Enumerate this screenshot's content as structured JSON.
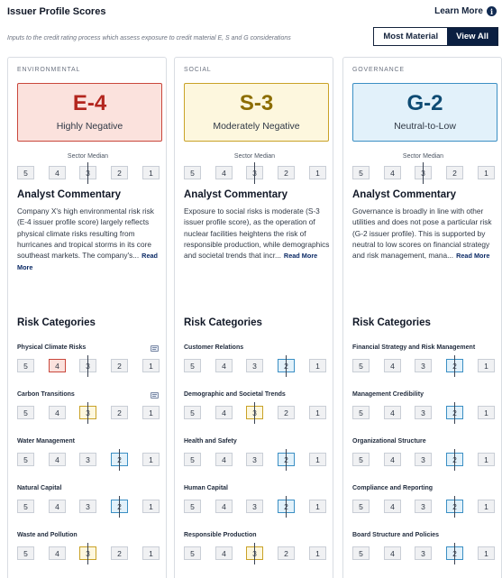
{
  "header": {
    "title": "Issuer Profile Scores",
    "learn_more": "Learn More",
    "info_icon": "info-icon",
    "subtitle": "Inputs to the credit rating process which assess exposure to credit material E, S and G considerations"
  },
  "toggle": {
    "most_material": "Most Material",
    "view_all": "View All",
    "active": "View All"
  },
  "colors": {
    "negative_fill": "#fbe2dd",
    "negative_border": "#c9473c",
    "negative_text": "#b3261e",
    "moderate_fill": "#fdf7de",
    "moderate_border": "#c9a227",
    "moderate_text": "#8c6d00",
    "neutral_fill": "#e2f1fa",
    "neutral_border": "#3b8fc4",
    "neutral_text": "#0e4b73",
    "scale_cell": "#f0f1f3"
  },
  "scale_labels": [
    "5",
    "4",
    "3",
    "2",
    "1"
  ],
  "panels": [
    {
      "label": "ENVIRONMENTAL",
      "score_code": "E-4",
      "score_desc": "Highly Negative",
      "tone": "negative",
      "median_label": "Sector Median",
      "median_score": 3,
      "commentary_title": "Analyst Commentary",
      "commentary": "Company X's high environmental risk risk (E-4 issuer profile score) largely reflects physical climate risks resulting from hurricanes and tropical storms in its core southeast markets. The company's...",
      "read_more": "Read More",
      "risk_title": "Risk Categories",
      "categories": [
        {
          "name": "Physical Climate Risks",
          "score": 4,
          "tone": "negative",
          "tick": 3,
          "note_icon": true
        },
        {
          "name": "Carbon Transitions",
          "score": 3,
          "tone": "moderate",
          "tick": 3,
          "note_icon": true
        },
        {
          "name": "Water Management",
          "score": 2,
          "tone": "neutral",
          "tick": 2,
          "note_icon": false
        },
        {
          "name": "Natural Capital",
          "score": 2,
          "tone": "neutral",
          "tick": 2,
          "note_icon": false
        },
        {
          "name": "Waste and Pollution",
          "score": 3,
          "tone": "moderate",
          "tick": 3,
          "note_icon": false
        }
      ]
    },
    {
      "label": "SOCIAL",
      "score_code": "S-3",
      "score_desc": "Moderately Negative",
      "tone": "moderate",
      "median_label": "Sector Median",
      "median_score": 3,
      "commentary_title": "Analyst Commentary",
      "commentary": "Exposure to social risks is moderate (S-3 issuer profile score), as the operation of nuclear facilities heightens the risk of responsible production, while demographics and societal trends that incr...",
      "read_more": "Read More",
      "risk_title": "Risk Categories",
      "categories": [
        {
          "name": "Customer Relations",
          "score": 2,
          "tone": "neutral",
          "tick": 2,
          "note_icon": false
        },
        {
          "name": "Demographic and Societal Trends",
          "score": 3,
          "tone": "moderate",
          "tick": 3,
          "note_icon": false
        },
        {
          "name": "Health and Safety",
          "score": 2,
          "tone": "neutral",
          "tick": 2,
          "note_icon": false
        },
        {
          "name": "Human Capital",
          "score": 2,
          "tone": "neutral",
          "tick": 2,
          "note_icon": false
        },
        {
          "name": "Responsible Production",
          "score": 3,
          "tone": "moderate",
          "tick": 3,
          "note_icon": false
        }
      ]
    },
    {
      "label": "GOVERNANCE",
      "score_code": "G-2",
      "score_desc": "Neutral-to-Low",
      "tone": "neutral",
      "median_label": "Sector Median",
      "median_score": 3,
      "commentary_title": "Analyst Commentary",
      "commentary": "Governance is broadly in line with other utilities and does not pose a particular risk (G-2 issuer profile). This is supported by neutral to low scores on financial strategy and risk management, mana...",
      "read_more": "Read More",
      "risk_title": "Risk Categories",
      "categories": [
        {
          "name": "Financial Strategy and Risk Management",
          "score": 2,
          "tone": "neutral",
          "tick": 2,
          "note_icon": false
        },
        {
          "name": "Management Credibility",
          "score": 2,
          "tone": "neutral",
          "tick": 2,
          "note_icon": false
        },
        {
          "name": "Organizational Structure",
          "score": 2,
          "tone": "neutral",
          "tick": 2,
          "note_icon": false
        },
        {
          "name": "Compliance and Reporting",
          "score": 2,
          "tone": "neutral",
          "tick": 2,
          "note_icon": false
        },
        {
          "name": "Board Structure and Policies",
          "score": 2,
          "tone": "neutral",
          "tick": 2,
          "note_icon": false
        }
      ]
    }
  ]
}
